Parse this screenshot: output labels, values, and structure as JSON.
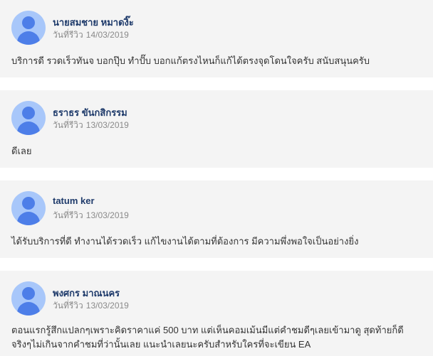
{
  "review_date_label": "วันที่รีวิว",
  "reviews": [
    {
      "name": "นายสมชาย หมาดงิ๊ะ",
      "date": "14/03/2019",
      "comment": "บริการดี รวดเร็วทันจ บอกปุ๊บ ทำปั๊บ บอกแก้ตรงไหนก็แก้ได้ตรงจุดโดนใจครับ สนับสนุนครับ"
    },
    {
      "name": "ธราธร ขันกสิกรรม",
      "date": "13/03/2019",
      "comment": "ดีเลย"
    },
    {
      "name": "tatum ker",
      "date": "13/03/2019",
      "comment": "ได้รับบริการที่ดี ทำงานได้รวดเร็ว แก้ไขงานได้ตามที่ต้องการ มีความพึ่งพอใจเป็นอย่างยิ่ง"
    },
    {
      "name": "พงศกร มาณนคร",
      "date": "13/03/2019",
      "comment": "ตอนแรกรู้สึกแปลกๆเพราะคิดราคาแค่ 500 บาท แต่เห็นคอมเม้นมีแต่คำชมดีๆเลยเข้ามาดู สุดท้ายก็ดีจริงๆไม่เกินจากคำชมที่ว่านั้นเลย แนะนำเลยนะครับสำหรับใครที่จะเขียน EA"
    }
  ]
}
